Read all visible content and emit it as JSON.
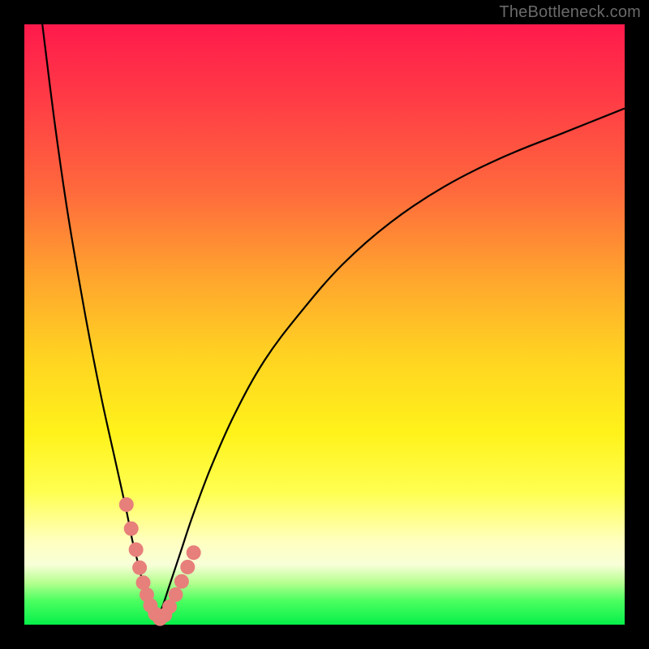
{
  "watermark": "TheBottleneck.com",
  "colors": {
    "curve_stroke": "#000000",
    "marker_fill": "#e77f7b",
    "marker_stroke": "#e77f7b"
  },
  "chart_data": {
    "type": "line",
    "title": "",
    "xlabel": "",
    "ylabel": "",
    "xlim": [
      0,
      100
    ],
    "ylim": [
      0,
      100
    ],
    "grid": false,
    "legend": false,
    "series": [
      {
        "name": "bottleneck-curve-left",
        "x": [
          3,
          5,
          7,
          9,
          11,
          13,
          15,
          17,
          18,
          19,
          20,
          21,
          22
        ],
        "values": [
          100,
          84,
          70,
          58,
          47,
          37,
          28,
          19,
          14,
          10,
          6,
          3,
          1
        ]
      },
      {
        "name": "bottleneck-curve-right",
        "x": [
          22,
          23,
          24,
          26,
          28,
          31,
          35,
          40,
          46,
          53,
          61,
          70,
          80,
          90,
          100
        ],
        "values": [
          1,
          3,
          6,
          12,
          18,
          26,
          35,
          44,
          52,
          60,
          67,
          73,
          78,
          82,
          86
        ]
      }
    ],
    "markers": {
      "name": "highlighted-points",
      "x": [
        17.0,
        17.8,
        18.6,
        19.2,
        19.8,
        20.4,
        21.0,
        21.8,
        22.6,
        23.4,
        24.2,
        25.2,
        26.2,
        27.2,
        28.2
      ],
      "values": [
        20.0,
        16.0,
        12.5,
        9.5,
        7.0,
        5.0,
        3.2,
        1.8,
        1.0,
        1.6,
        3.0,
        5.0,
        7.2,
        9.6,
        12.0
      ],
      "style": "circle"
    }
  }
}
